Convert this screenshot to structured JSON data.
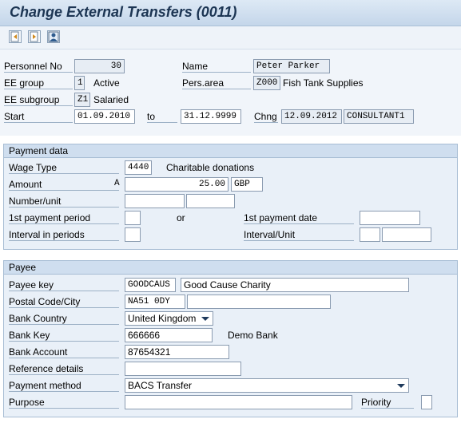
{
  "window": {
    "title": "Change External Transfers (0011)"
  },
  "toolbar": {
    "buttons": [
      "previous-record-icon",
      "next-record-icon",
      "overview-icon"
    ]
  },
  "header": {
    "personnel_no_label": "Personnel No",
    "personnel_no": "30",
    "name_label": "Name",
    "name": "Peter Parker",
    "ee_group_label": "EE group",
    "ee_group_code": "1",
    "ee_group_text": "Active",
    "pers_area_label": "Pers.area",
    "pers_area_code": "Z000",
    "pers_area_text": "Fish Tank Supplies",
    "ee_subgroup_label": "EE subgroup",
    "ee_subgroup_code": "Z1",
    "ee_subgroup_text": "Salaried",
    "start_label": "Start",
    "start_date": "01.09.2010",
    "to_label": "to",
    "end_date": "31.12.9999",
    "chng_label": "Chng",
    "chng_date": "12.09.2012",
    "chng_user": "CONSULTANT1"
  },
  "payment": {
    "title": "Payment data",
    "wage_type_label": "Wage Type",
    "wage_type": "4440",
    "wage_type_text": "Charitable donations",
    "amount_label": "Amount",
    "amount_sign": "A",
    "amount": "25.00",
    "currency": "GBP",
    "number_unit_label": "Number/unit",
    "first_period_label": "1st payment period",
    "or_label": "or",
    "first_date_label": "1st payment date",
    "interval_periods_label": "Interval in periods",
    "interval_unit_label": "Interval/Unit"
  },
  "payee": {
    "title": "Payee",
    "payee_key_label": "Payee key",
    "payee_key": "GOODCAUS",
    "payee_name": "Good Cause Charity",
    "postal_label": "Postal Code/City",
    "postal_code": "NA51 0DY",
    "city": "",
    "bank_country_label": "Bank Country",
    "bank_country": "United Kingdom",
    "bank_key_label": "Bank Key",
    "bank_key": "666666",
    "bank_name": "Demo Bank",
    "bank_account_label": "Bank Account",
    "bank_account": "87654321",
    "reference_label": "Reference details",
    "reference": "",
    "payment_method_label": "Payment method",
    "payment_method": "BACS Transfer",
    "purpose_label": "Purpose",
    "purpose": "",
    "priority_label": "Priority",
    "priority": ""
  }
}
